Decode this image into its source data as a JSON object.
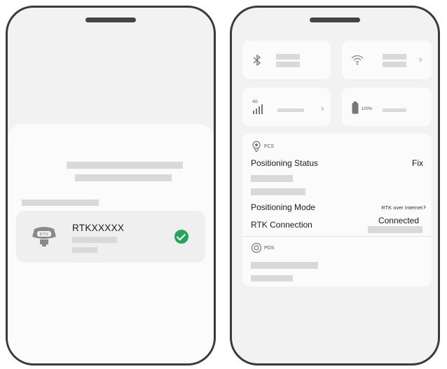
{
  "left_phone": {
    "device": {
      "name": "RTKXXXXX",
      "icon_label": "RTK"
    }
  },
  "right_phone": {
    "tiles": {
      "bluetooth_icon": "bluetooth-icon",
      "wifi_icon": "wifi-icon",
      "cellular": {
        "icon": "cellular-icon",
        "badge": "4G"
      },
      "battery": {
        "icon": "battery-icon",
        "percent": "100%"
      }
    },
    "fcs": {
      "section_label": "FCS",
      "status_label": "Positioning Status",
      "status_value": "Fix",
      "mode_label": "Positioning Mode",
      "mode_value": "RTK over Internet",
      "connection_label": "RTK Connection",
      "connection_value": "Connected"
    },
    "pds": {
      "section_label": "PDS"
    }
  },
  "colors": {
    "frame": "#3a3a3a",
    "check_green": "#27a35a",
    "placeholder": "#d9d9d9"
  }
}
